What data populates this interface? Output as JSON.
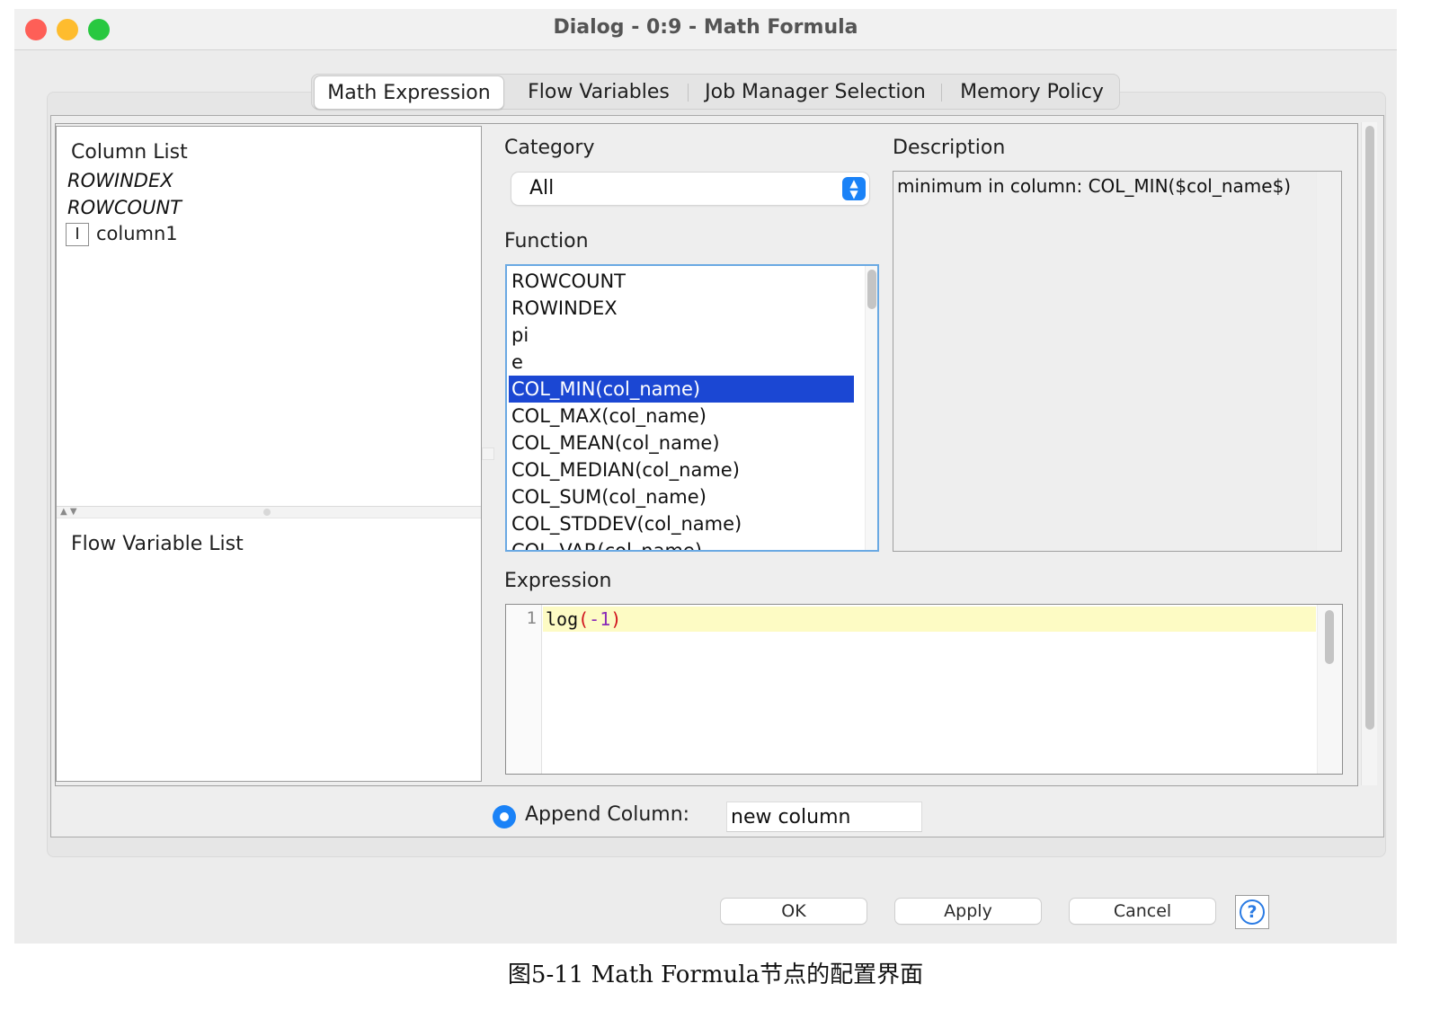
{
  "window": {
    "title": "Dialog - 0:9 - Math Formula",
    "traffic_colors": {
      "close": "#fe5f57",
      "minimize": "#febc2e",
      "zoom": "#28c840"
    }
  },
  "tabs": [
    {
      "label": "Math Expression",
      "active": true
    },
    {
      "label": "Flow Variables",
      "active": false
    },
    {
      "label": "Job Manager Selection",
      "active": false
    },
    {
      "label": "Memory Policy",
      "active": false
    }
  ],
  "column_list": {
    "title": "Column List",
    "items": [
      "ROWINDEX",
      "ROWCOUNT"
    ],
    "columns": [
      {
        "type_icon": "I",
        "name": "column1"
      }
    ]
  },
  "flow_variable_list": {
    "title": "Flow Variable List"
  },
  "category": {
    "label": "Category",
    "selected": "All"
  },
  "function": {
    "label": "Function",
    "items": [
      "ROWCOUNT",
      "ROWINDEX",
      "pi",
      "e",
      "COL_MIN(col_name)",
      "COL_MAX(col_name)",
      "COL_MEAN(col_name)",
      "COL_MEDIAN(col_name)",
      "COL_SUM(col_name)",
      "COL_STDDEV(col_name)",
      "COL_VAR(col_name)"
    ],
    "selected_index": 4
  },
  "description": {
    "label": "Description",
    "text": "minimum in column: COL_MIN($col_name$)"
  },
  "expression": {
    "label": "Expression",
    "line_number": "1",
    "code_tokens": [
      {
        "text": "log",
        "color": "#111111"
      },
      {
        "text": "(",
        "color": "#d0101b"
      },
      {
        "text": "-1",
        "color": "#8a2bb8"
      },
      {
        "text": ")",
        "color": "#d0101b"
      }
    ]
  },
  "append": {
    "label": "Append Column:",
    "value": "new column"
  },
  "buttons": {
    "ok": "OK",
    "apply": "Apply",
    "cancel": "Cancel",
    "help": "?"
  },
  "caption": "图5-11 Math Formula节点的配置界面",
  "colors": {
    "accent": "#1a82f7",
    "selection": "#1b47d3",
    "current_line": "#fdfbc4"
  }
}
